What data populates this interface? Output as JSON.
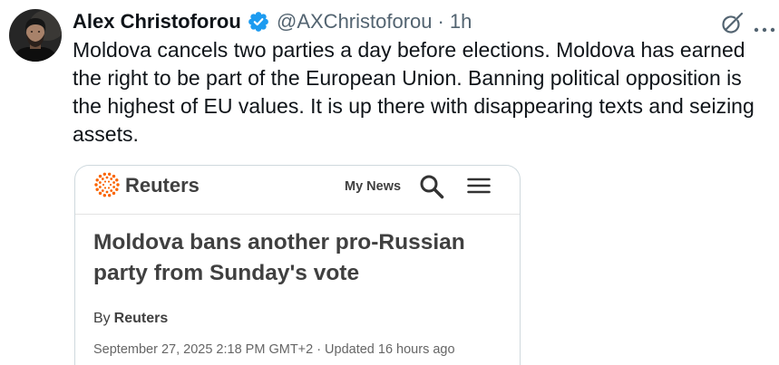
{
  "tweet": {
    "author": {
      "name": "Alex Christoforou",
      "handle": "@AXChristoforou",
      "verified": true
    },
    "separator": "·",
    "time": "1h",
    "text_lines": [
      "Moldova cancels two parties a day before elections. Moldova has earned",
      "the right to be part of the European Union. Banning political opposition is",
      "the highest of EU values. It is up there with disappearing texts and seizing",
      "assets."
    ],
    "icons": {
      "verified": "verified-badge-icon",
      "grok": "grok-icon",
      "more": "more-icon"
    }
  },
  "embed": {
    "publisher": "Reuters",
    "logo": "reuters-logo",
    "nav": {
      "my_news": "My News",
      "search_icon": "search-icon",
      "menu_icon": "menu-icon"
    },
    "headline_lines": [
      "Moldova bans another pro-Russian",
      "party from Sunday's vote"
    ],
    "byline": {
      "prefix": "By",
      "author": "Reuters"
    },
    "published": "September 27, 2025 2:18 PM GMT+2",
    "separator": "·",
    "updated": "Updated 16 hours ago"
  },
  "colors": {
    "text": "#0f1419",
    "secondary_text": "#536471",
    "verified_blue": "#1d9bf0",
    "card_border": "#cfd9de",
    "reuters_orange": "#fa6400",
    "article_text": "#404040",
    "article_meta": "#666666"
  }
}
